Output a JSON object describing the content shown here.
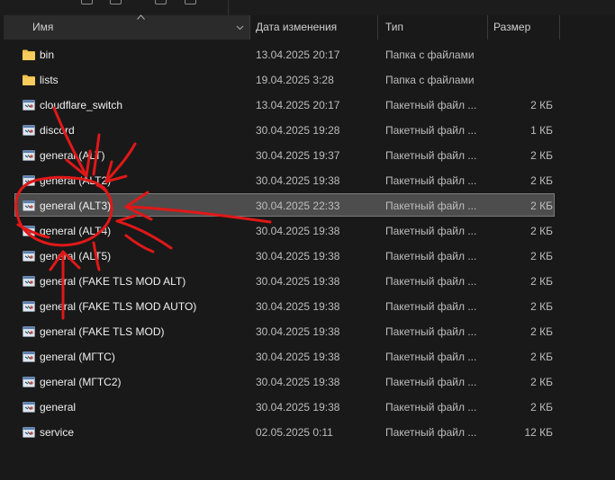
{
  "header": {
    "name": "Имя",
    "date": "Дата изменения",
    "type": "Тип",
    "size": "Размер"
  },
  "files": [
    {
      "name": "bin",
      "date": "13.04.2025 20:17",
      "type": "Папка с файлами",
      "size": "",
      "icon": "folder-icon"
    },
    {
      "name": "lists",
      "date": "19.04.2025 3:28",
      "type": "Папка с файлами",
      "size": "",
      "icon": "folder-icon"
    },
    {
      "name": "cloudflare_switch",
      "date": "13.04.2025 20:17",
      "type": "Пакетный файл ...",
      "size": "2 КБ",
      "icon": "batch-file-icon"
    },
    {
      "name": "discord",
      "date": "30.04.2025 19:28",
      "type": "Пакетный файл ...",
      "size": "1 КБ",
      "icon": "batch-file-icon"
    },
    {
      "name": "general (ALT)",
      "date": "30.04.2025 19:37",
      "type": "Пакетный файл ...",
      "size": "2 КБ",
      "icon": "batch-file-icon"
    },
    {
      "name": "general (ALT2)",
      "date": "30.04.2025 19:38",
      "type": "Пакетный файл ...",
      "size": "2 КБ",
      "icon": "batch-file-icon"
    },
    {
      "name": "general (ALT3)",
      "date": "30.04.2025 22:33",
      "type": "Пакетный файл ...",
      "size": "2 КБ",
      "icon": "batch-file-icon",
      "selected": true
    },
    {
      "name": "general (ALT4)",
      "date": "30.04.2025 19:38",
      "type": "Пакетный файл ...",
      "size": "2 КБ",
      "icon": "batch-file-icon"
    },
    {
      "name": "general (ALT5)",
      "date": "30.04.2025 19:38",
      "type": "Пакетный файл ...",
      "size": "2 КБ",
      "icon": "batch-file-icon"
    },
    {
      "name": "general (FAKE TLS MOD ALT)",
      "date": "30.04.2025 19:38",
      "type": "Пакетный файл ...",
      "size": "2 КБ",
      "icon": "batch-file-icon"
    },
    {
      "name": "general (FAKE TLS MOD AUTO)",
      "date": "30.04.2025 19:38",
      "type": "Пакетный файл ...",
      "size": "2 КБ",
      "icon": "batch-file-icon"
    },
    {
      "name": "general (FAKE TLS MOD)",
      "date": "30.04.2025 19:38",
      "type": "Пакетный файл ...",
      "size": "2 КБ",
      "icon": "batch-file-icon"
    },
    {
      "name": "general (МГТС)",
      "date": "30.04.2025 19:38",
      "type": "Пакетный файл ...",
      "size": "2 КБ",
      "icon": "batch-file-icon"
    },
    {
      "name": "general (МГТС2)",
      "date": "30.04.2025 19:38",
      "type": "Пакетный файл ...",
      "size": "2 КБ",
      "icon": "batch-file-icon"
    },
    {
      "name": "general",
      "date": "30.04.2025 19:38",
      "type": "Пакетный файл ...",
      "size": "2 КБ",
      "icon": "batch-file-icon"
    },
    {
      "name": "service",
      "date": "02.05.2025 0:11",
      "type": "Пакетный файл ...",
      "size": "12 КБ",
      "icon": "batch-file-icon"
    }
  ],
  "colors": {
    "background": "#191919",
    "selection": "#4d4d4d",
    "folder": "#f2c14e",
    "annotation": "#e01818"
  }
}
